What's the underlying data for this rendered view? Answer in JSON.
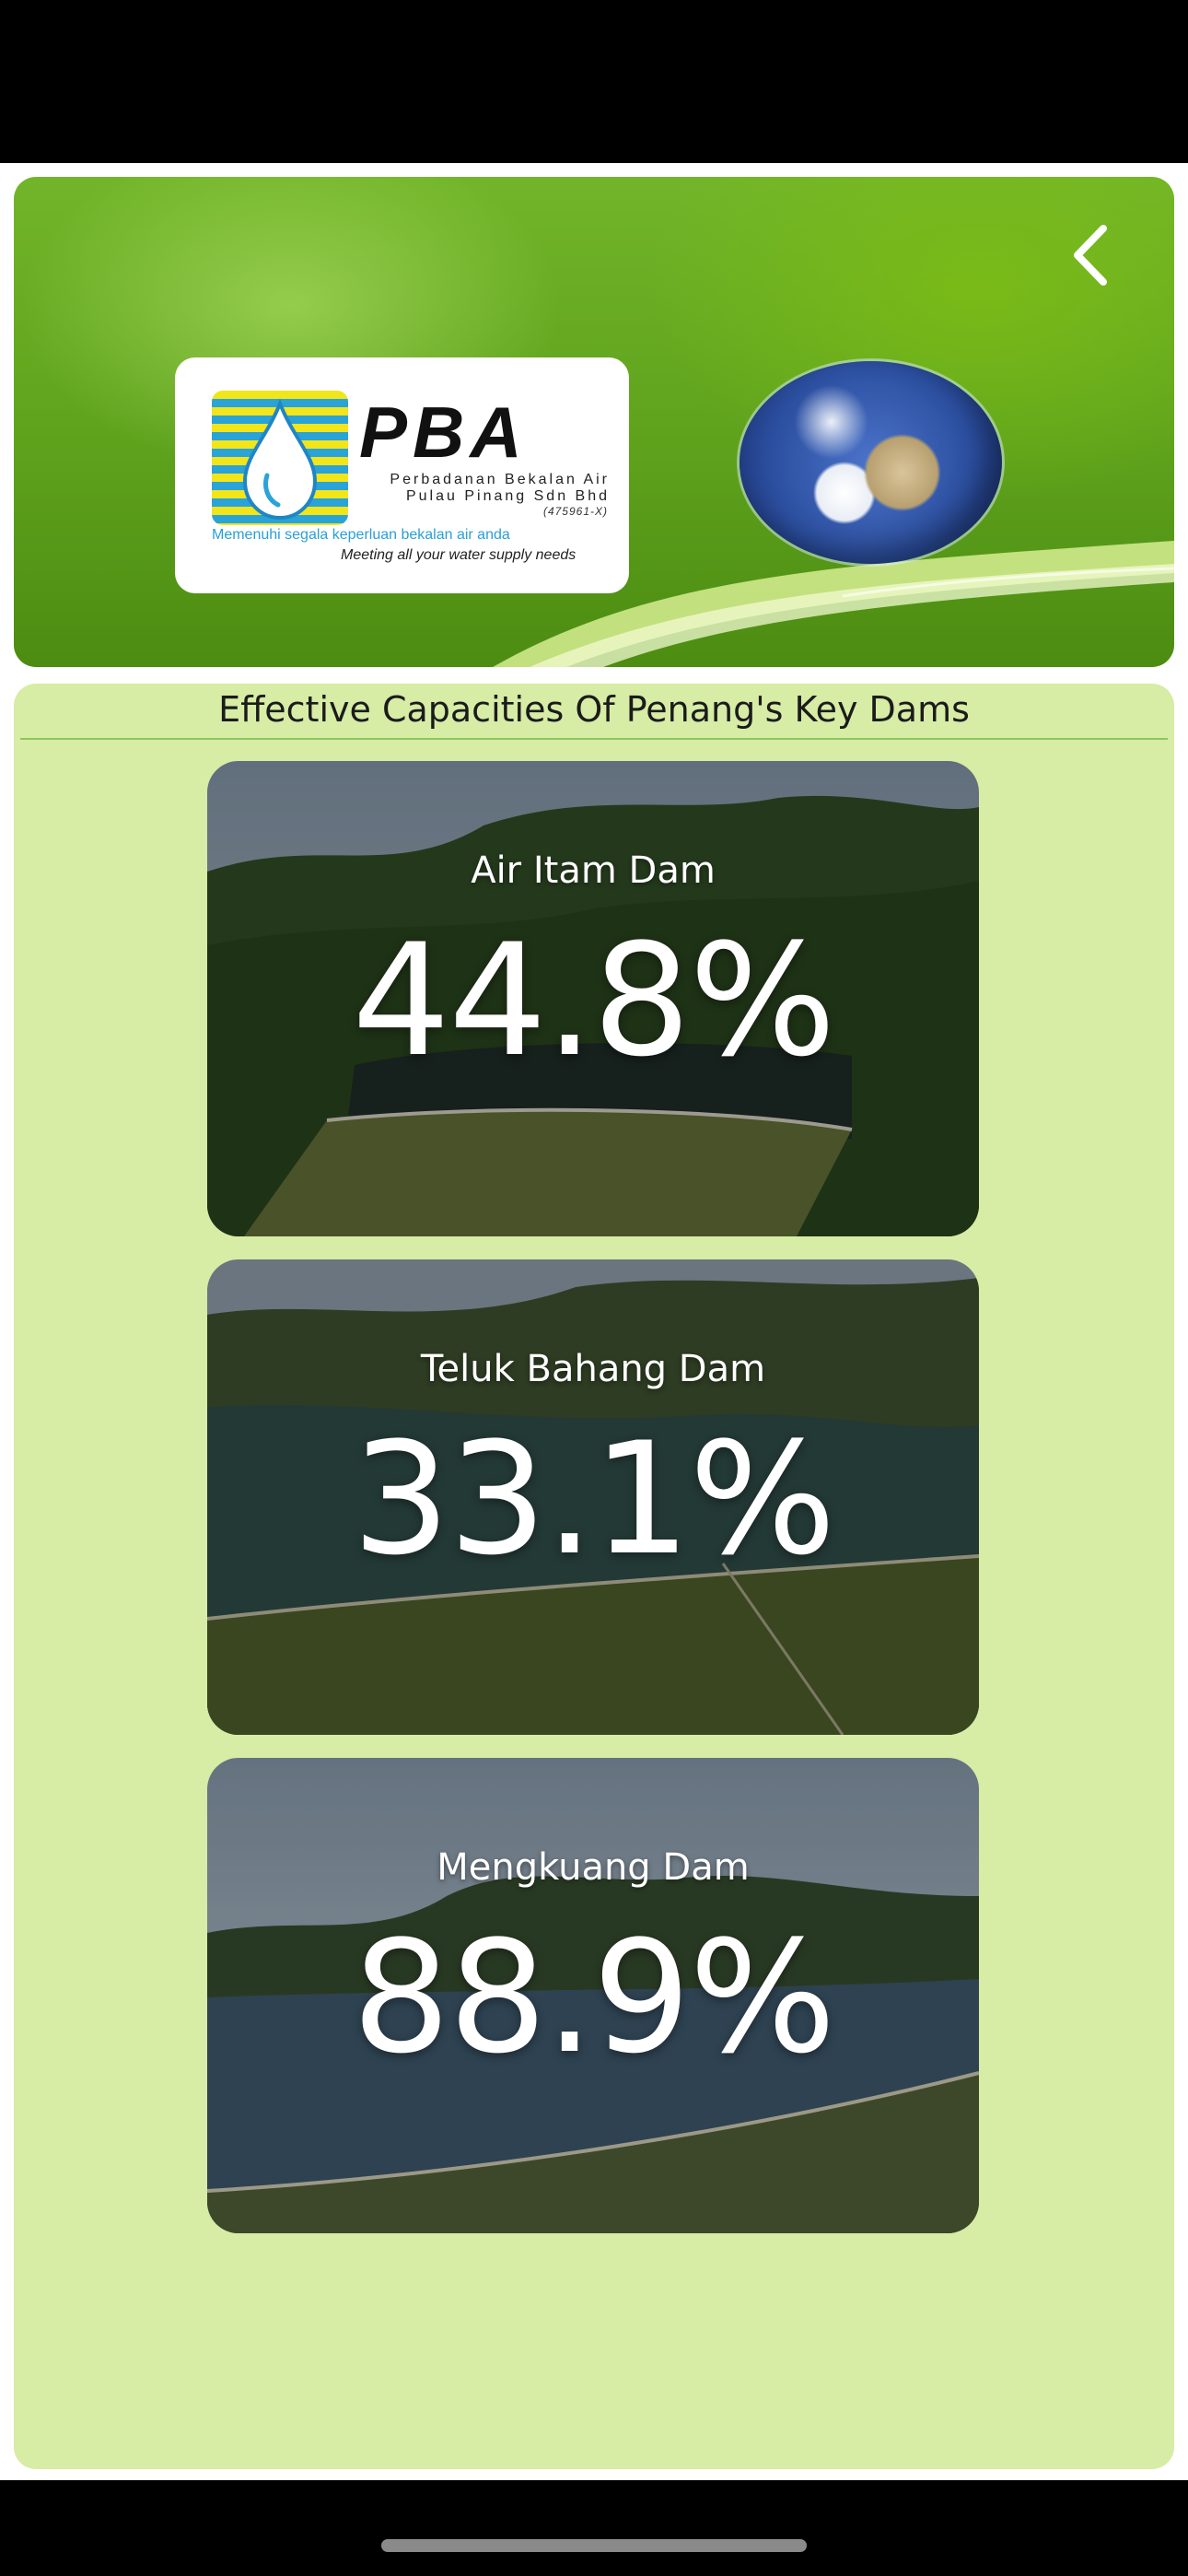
{
  "header": {
    "back_icon": "chevron-left-icon",
    "logo": {
      "title": "PBA",
      "company_line1": "Perbadanan Bekalan Air",
      "company_line2": "Pulau Pinang Sdn Bhd",
      "registration": "(475961-X)",
      "tagline_ms": "Memenuhi segala keperluan bekalan air anda",
      "tagline_en": "Meeting all your water supply needs",
      "colors": {
        "yellow": "#f2e51a",
        "blue": "#29a3d8"
      }
    }
  },
  "main": {
    "title": "Effective Capacities Of Penang's Key Dams",
    "dams": [
      {
        "name": "Air Itam Dam",
        "capacity": "44.8%"
      },
      {
        "name": "Teluk Bahang Dam",
        "capacity": "33.1%"
      },
      {
        "name": "Mengkuang Dam",
        "capacity": "88.9%"
      }
    ]
  },
  "colors": {
    "banner_green": "#5ea21c",
    "panel_background": "#d7eca5",
    "title_rule": "#8ec75a"
  }
}
